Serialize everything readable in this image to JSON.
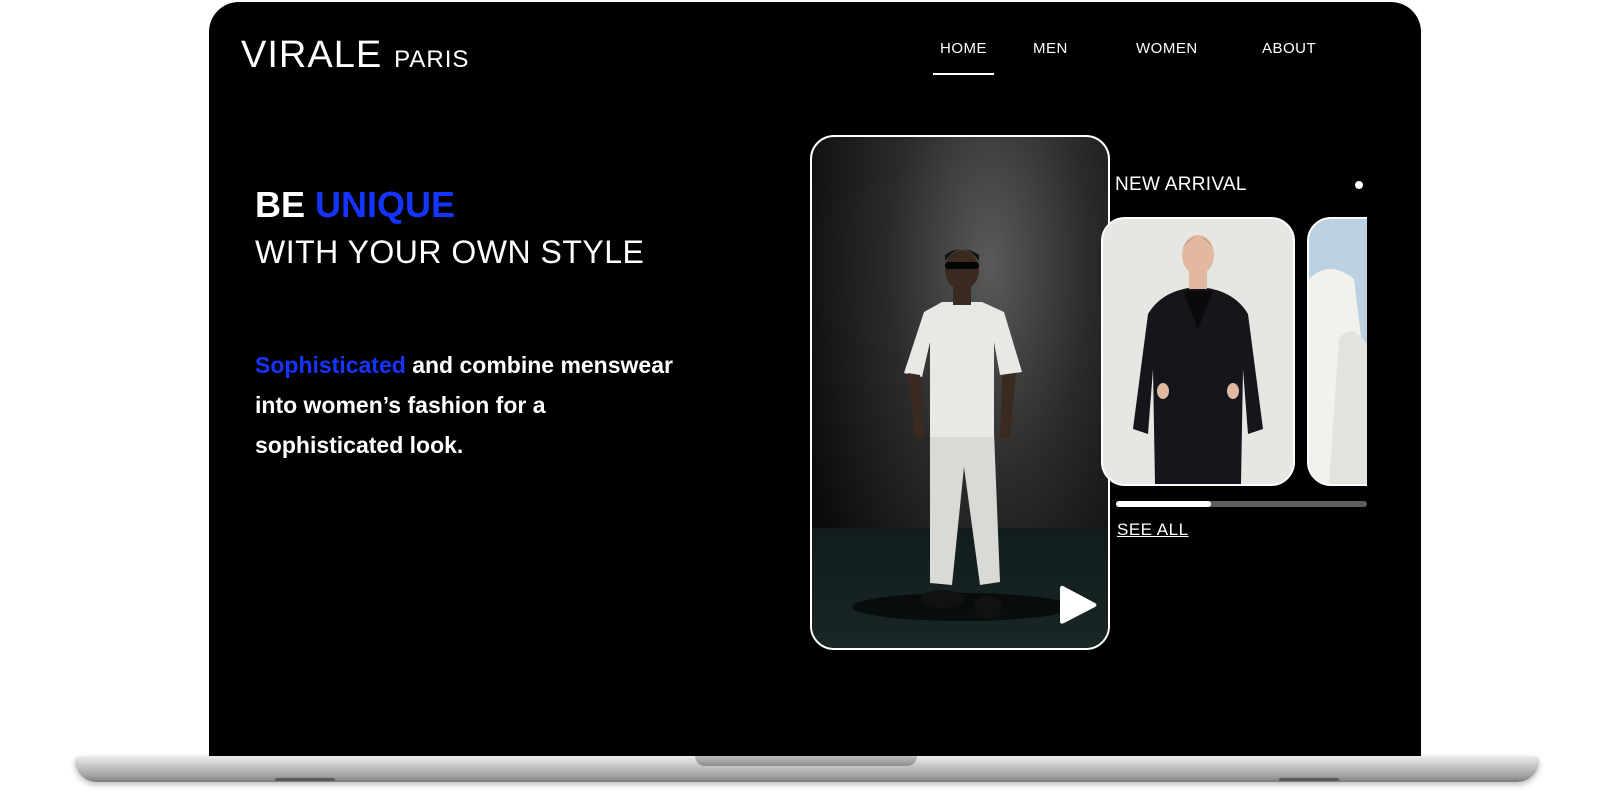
{
  "brand": {
    "name": "VIRALE",
    "sub": "PARIS"
  },
  "nav": [
    {
      "label": "HOME",
      "active": true
    },
    {
      "label": "MEN"
    },
    {
      "label": "WOMEN"
    },
    {
      "label": "ABOUT"
    }
  ],
  "hero": {
    "be": "BE",
    "unique": "UNIQUE",
    "subtitle": "WITH YOUR OWN STYLE",
    "desc_accent": "Sophisticated",
    "desc_rest": " and combine menswear into women’s fashion for a sophisticated look."
  },
  "new_arrival": {
    "title": "NEW ARRIVAL",
    "see_all": "SEE ALL",
    "progress": 0.38
  },
  "colors": {
    "accent": "#1634ff",
    "background": "#000000"
  },
  "icons": {
    "play": "play-icon"
  }
}
